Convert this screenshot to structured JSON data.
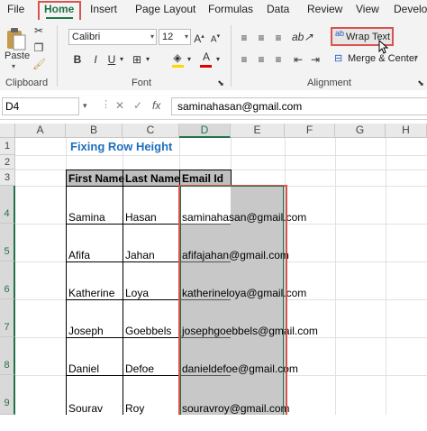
{
  "ribbon": {
    "tabs": [
      "File",
      "Home",
      "Insert",
      "Page Layout",
      "Formulas",
      "Data",
      "Review",
      "View",
      "Develop"
    ],
    "active_tab": "Home",
    "clipboard": {
      "paste_label": "Paste",
      "group_label": "Clipboard"
    },
    "font": {
      "name": "Calibri",
      "size": "12",
      "group_label": "Font",
      "bold": "B",
      "italic": "I",
      "underline": "U",
      "font_color": "#e00000",
      "fill_color": "#ffd700"
    },
    "alignment": {
      "wrap_text_label": "Wrap Text",
      "merge_label": "Merge & Center",
      "group_label": "Alignment"
    }
  },
  "formula_bar": {
    "name_box": "D4",
    "fx": "fx",
    "value": "saminahasan@gmail.com"
  },
  "grid": {
    "columns": [
      "A",
      "B",
      "C",
      "D",
      "E",
      "F",
      "G",
      "H"
    ],
    "selected_column": "D",
    "rows": [
      "1",
      "2",
      "3",
      "4",
      "5",
      "6",
      "7",
      "8",
      "9"
    ],
    "title": "Fixing Row Height",
    "title_color": "#1f6fbf",
    "headers": [
      "First Name",
      "Last Name",
      "Email Id"
    ],
    "records": [
      {
        "first": "Samina",
        "last": "Hasan",
        "email": "saminahasan@gmail.com"
      },
      {
        "first": "Afifa",
        "last": "Jahan",
        "email": "afifajahan@gmail.com"
      },
      {
        "first": "Katherine",
        "last": "Loya",
        "email": "katherineloya@gmail.com"
      },
      {
        "first": "Joseph",
        "last": "Goebbels",
        "email": "josephgoebbels@gmail.com"
      },
      {
        "first": "Daniel",
        "last": "Defoe",
        "email": "danieldefoe@gmail.com"
      },
      {
        "first": "Sourav",
        "last": "Roy",
        "email": "souravroy@gmail.com"
      }
    ]
  }
}
